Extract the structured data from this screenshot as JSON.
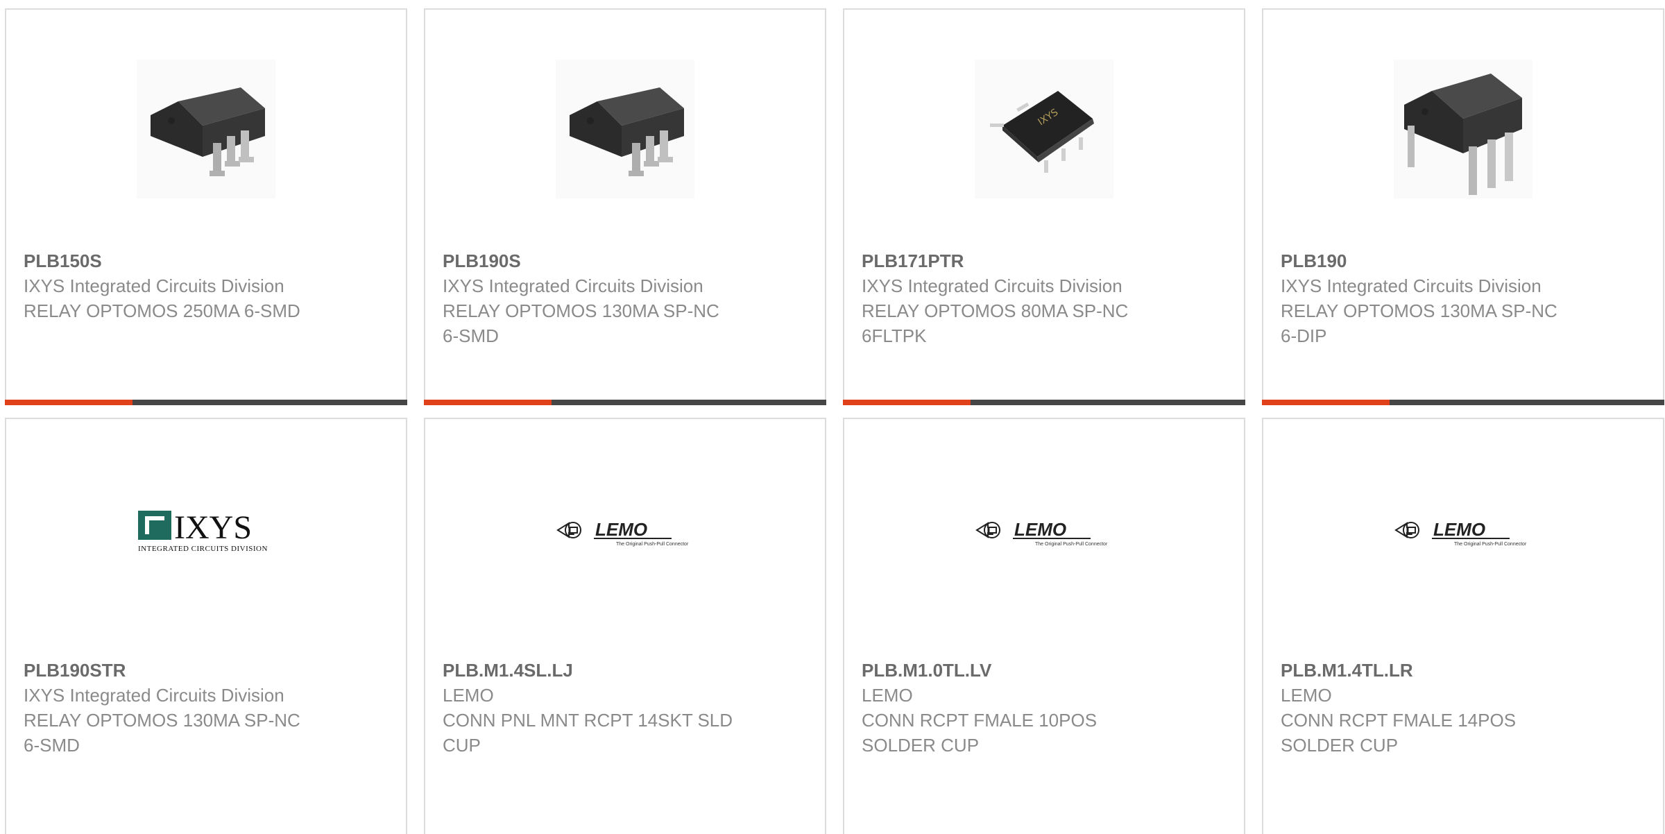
{
  "products": [
    {
      "part": "PLB150S",
      "manufacturer": "IXYS Integrated Circuits Division",
      "description": "RELAY OPTOMOS 250MA 6-SMD",
      "image": "dip-6-smd-package"
    },
    {
      "part": "PLB190S",
      "manufacturer": "IXYS Integrated Circuits Division",
      "description": "RELAY OPTOMOS 130MA SP-NC 6-SMD",
      "image": "dip-6-smd-package"
    },
    {
      "part": "PLB171PTR",
      "manufacturer": "IXYS Integrated Circuits Division",
      "description": "RELAY OPTOMOS 80MA SP-NC 6FLTPK",
      "image": "flatpack-package"
    },
    {
      "part": "PLB190",
      "manufacturer": "IXYS Integrated Circuits Division",
      "description": "RELAY OPTOMOS 130MA SP-NC 6-DIP",
      "image": "dip-6-package"
    },
    {
      "part": "PLB190STR",
      "manufacturer": "IXYS Integrated Circuits Division",
      "description": "RELAY OPTOMOS 130MA SP-NC 6-SMD",
      "image": "ixys-logo"
    },
    {
      "part": "PLB.M1.4SL.LJ",
      "manufacturer": "LEMO",
      "description": "CONN PNL MNT RCPT 14SKT SLD CUP",
      "image": "lemo-logo"
    },
    {
      "part": "PLB.M1.0TL.LV",
      "manufacturer": "LEMO",
      "description": "CONN RCPT FMALE 10POS SOLDER CUP",
      "image": "lemo-logo"
    },
    {
      "part": "PLB.M1.4TL.LR",
      "manufacturer": "LEMO",
      "description": "CONN RCPT FMALE 14POS SOLDER CUP",
      "image": "lemo-logo"
    }
  ],
  "logos": {
    "ixys_wordmark": "IXYS",
    "ixys_tagline": "Integrated Circuits Division",
    "lemo_wordmark": "LEMO",
    "lemo_tagline": "The Original Push-Pull Connector"
  },
  "colors": {
    "accent": "#e0401a",
    "bar": "#464646",
    "border": "#dcdcdc"
  }
}
